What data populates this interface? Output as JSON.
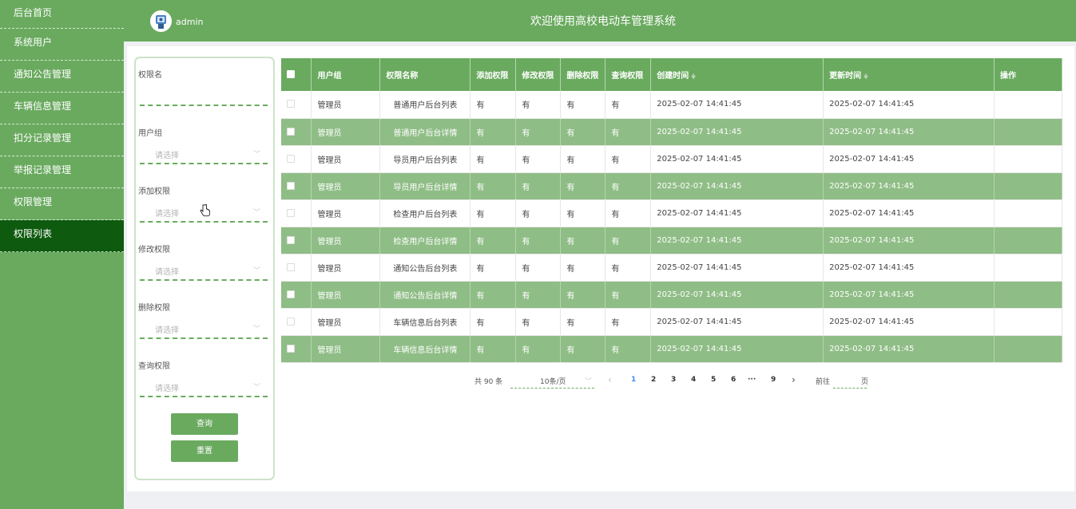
{
  "header": {
    "username": "admin",
    "title": "欢迎使用高校电动车管理系统"
  },
  "sidebar": {
    "items": [
      {
        "label": "后台首页"
      },
      {
        "label": "系统用户"
      },
      {
        "label": "通知公告管理"
      },
      {
        "label": "车辆信息管理"
      },
      {
        "label": "扣分记录管理"
      },
      {
        "label": "举报记录管理"
      },
      {
        "label": "权限管理"
      },
      {
        "label": "权限列表"
      }
    ],
    "active_index": 7
  },
  "search": {
    "fields": [
      {
        "label": "权限名",
        "placeholder": ""
      },
      {
        "label": "用户组",
        "placeholder": "请选择"
      },
      {
        "label": "添加权限",
        "placeholder": "请选择"
      },
      {
        "label": "修改权限",
        "placeholder": "请选择"
      },
      {
        "label": "删除权限",
        "placeholder": "请选择"
      },
      {
        "label": "查询权限",
        "placeholder": "请选择"
      }
    ],
    "query_button": "查询",
    "reset_button": "重置"
  },
  "table": {
    "columns": [
      "用户组",
      "权限名称",
      "添加权限",
      "修改权限",
      "删除权限",
      "查询权限",
      "创建时间",
      "更新时间",
      "操作"
    ],
    "sort_glyph": "≑",
    "rows": [
      [
        "管理员",
        "普通用户后台列表",
        "有",
        "有",
        "有",
        "有",
        "2025-02-07 14:41:45",
        "2025-02-07 14:41:45"
      ],
      [
        "管理员",
        "普通用户后台详情",
        "有",
        "有",
        "有",
        "有",
        "2025-02-07 14:41:45",
        "2025-02-07 14:41:45"
      ],
      [
        "管理员",
        "导员用户后台列表",
        "有",
        "有",
        "有",
        "有",
        "2025-02-07 14:41:45",
        "2025-02-07 14:41:45"
      ],
      [
        "管理员",
        "导员用户后台详情",
        "有",
        "有",
        "有",
        "有",
        "2025-02-07 14:41:45",
        "2025-02-07 14:41:45"
      ],
      [
        "管理员",
        "检查用户后台列表",
        "有",
        "有",
        "有",
        "有",
        "2025-02-07 14:41:45",
        "2025-02-07 14:41:45"
      ],
      [
        "管理员",
        "检查用户后台详情",
        "有",
        "有",
        "有",
        "有",
        "2025-02-07 14:41:45",
        "2025-02-07 14:41:45"
      ],
      [
        "管理员",
        "通知公告后台列表",
        "有",
        "有",
        "有",
        "有",
        "2025-02-07 14:41:45",
        "2025-02-07 14:41:45"
      ],
      [
        "管理员",
        "通知公告后台详情",
        "有",
        "有",
        "有",
        "有",
        "2025-02-07 14:41:45",
        "2025-02-07 14:41:45"
      ],
      [
        "管理员",
        "车辆信息后台列表",
        "有",
        "有",
        "有",
        "有",
        "2025-02-07 14:41:45",
        "2025-02-07 14:41:45"
      ],
      [
        "管理员",
        "车辆信息后台详情",
        "有",
        "有",
        "有",
        "有",
        "2025-02-07 14:41:45",
        "2025-02-07 14:41:45"
      ]
    ]
  },
  "pagination": {
    "total_text": "共 90 条",
    "page_size": "10条/页",
    "prev_glyph": "‹",
    "next_glyph": "›",
    "pages": [
      "1",
      "2",
      "3",
      "4",
      "5",
      "6",
      "···",
      "9"
    ],
    "active_page": "1",
    "goto_label": "前往",
    "goto_suffix": "页"
  },
  "colors": {
    "primary": "#6aaa5f",
    "active_nav": "#0e5a0e",
    "alt_row": "#8fbd86",
    "page_active": "#3f8ff0"
  }
}
